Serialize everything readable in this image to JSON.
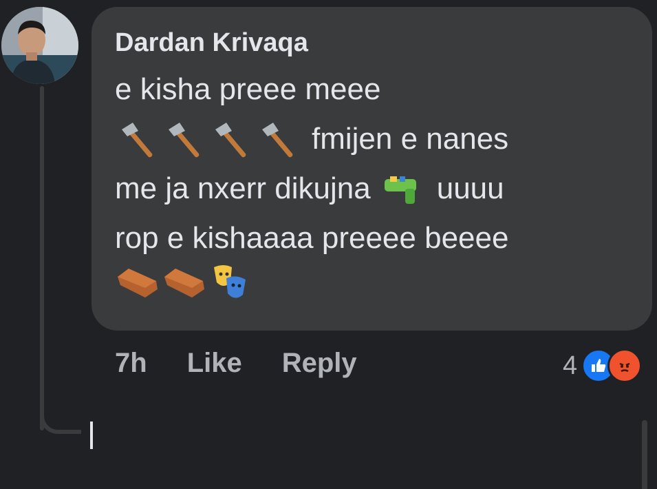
{
  "comment": {
    "author": "Dardan Krivaqa",
    "lines": [
      {
        "text_after": "e kisha preee meee"
      },
      {
        "text_after": "fmijen e nanes"
      },
      {
        "text_before": "me ja nxerr dikujna",
        "text_after": "uuuu"
      },
      {
        "text_after": "rop e kishaaaa preeee beeee"
      }
    ],
    "emojis": {
      "line2": [
        "axe-icon",
        "axe-icon",
        "axe-icon",
        "axe-icon"
      ],
      "line3": [
        "water-pistol-icon"
      ],
      "line5": [
        "coffin-icon",
        "coffin-icon",
        "performing-arts-icon"
      ]
    }
  },
  "actions": {
    "time": "7h",
    "like_label": "Like",
    "reply_label": "Reply"
  },
  "reactions": {
    "count": "4",
    "types": [
      "like-reaction-icon",
      "angry-reaction-icon"
    ]
  },
  "colors": {
    "background": "#202124",
    "bubble": "#3a3b3c",
    "text": "#e4e6eb",
    "muted": "#b0b3b8",
    "like_blue": "#1877f2",
    "angry_orange": "#f0522e"
  }
}
